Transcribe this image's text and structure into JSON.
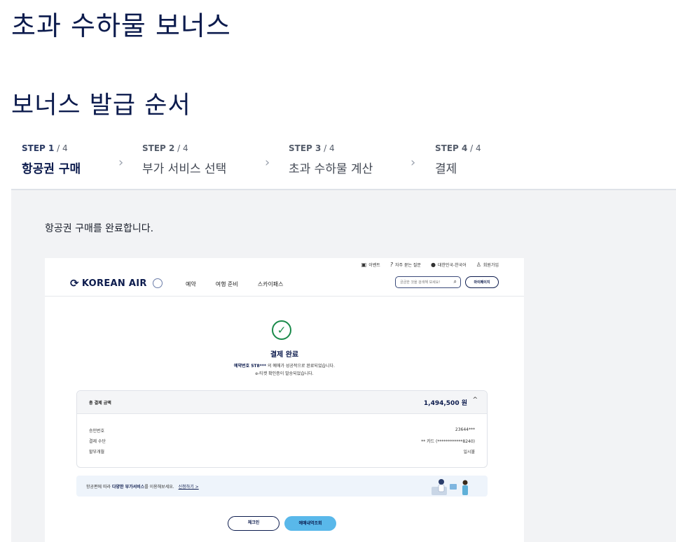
{
  "page": {
    "title": "초과 수하물 보너스",
    "section_title": "보너스 발급 순서"
  },
  "steps": [
    {
      "num": "STEP 1",
      "total": " / 4",
      "label": "항공권 구매"
    },
    {
      "num": "STEP 2",
      "total": " / 4",
      "label": "부가 서비스 선택"
    },
    {
      "num": "STEP 3",
      "total": " / 4",
      "label": "초과 수하물 계산"
    },
    {
      "num": "STEP 4",
      "total": " / 4",
      "label": "결제"
    }
  ],
  "content": {
    "description": "항공권 구매를 완료합니다."
  },
  "screenshot": {
    "util": [
      "이벤트",
      "자주 묻는 질문",
      "대한민국-한국어",
      "회원가입"
    ],
    "logo_text": "KOREAN AIR",
    "nav": [
      "예약",
      "여행 준비",
      "스카이패스"
    ],
    "search_placeholder": "궁금한 것을 검색해 보세요!",
    "mypage": "마이페이지",
    "done_title": "결제 완료",
    "done_line1_bold": "예약번호 5T8***",
    "done_line1_rest": " 의 예매가 성공적으로 완료되었습니다.",
    "done_line2": "e-티켓 확인증이 발송되었습니다.",
    "pay": {
      "label": "총 결제 금액",
      "amount": "1,494,500 원",
      "rows": [
        {
          "label": "승인번호",
          "value": "23644***"
        },
        {
          "label": "결제 수단",
          "value": "** 카드 (************8240)"
        },
        {
          "label": "할부개월",
          "value": "일시불"
        }
      ]
    },
    "banner": {
      "pre": "항공편에 따라 ",
      "bold": "다양한 부가서비스",
      "post": "를 이용해보세요.",
      "link": "신청하기 >"
    },
    "buttons": {
      "checkin": "체크인",
      "reservations": "예매내역조회"
    }
  }
}
